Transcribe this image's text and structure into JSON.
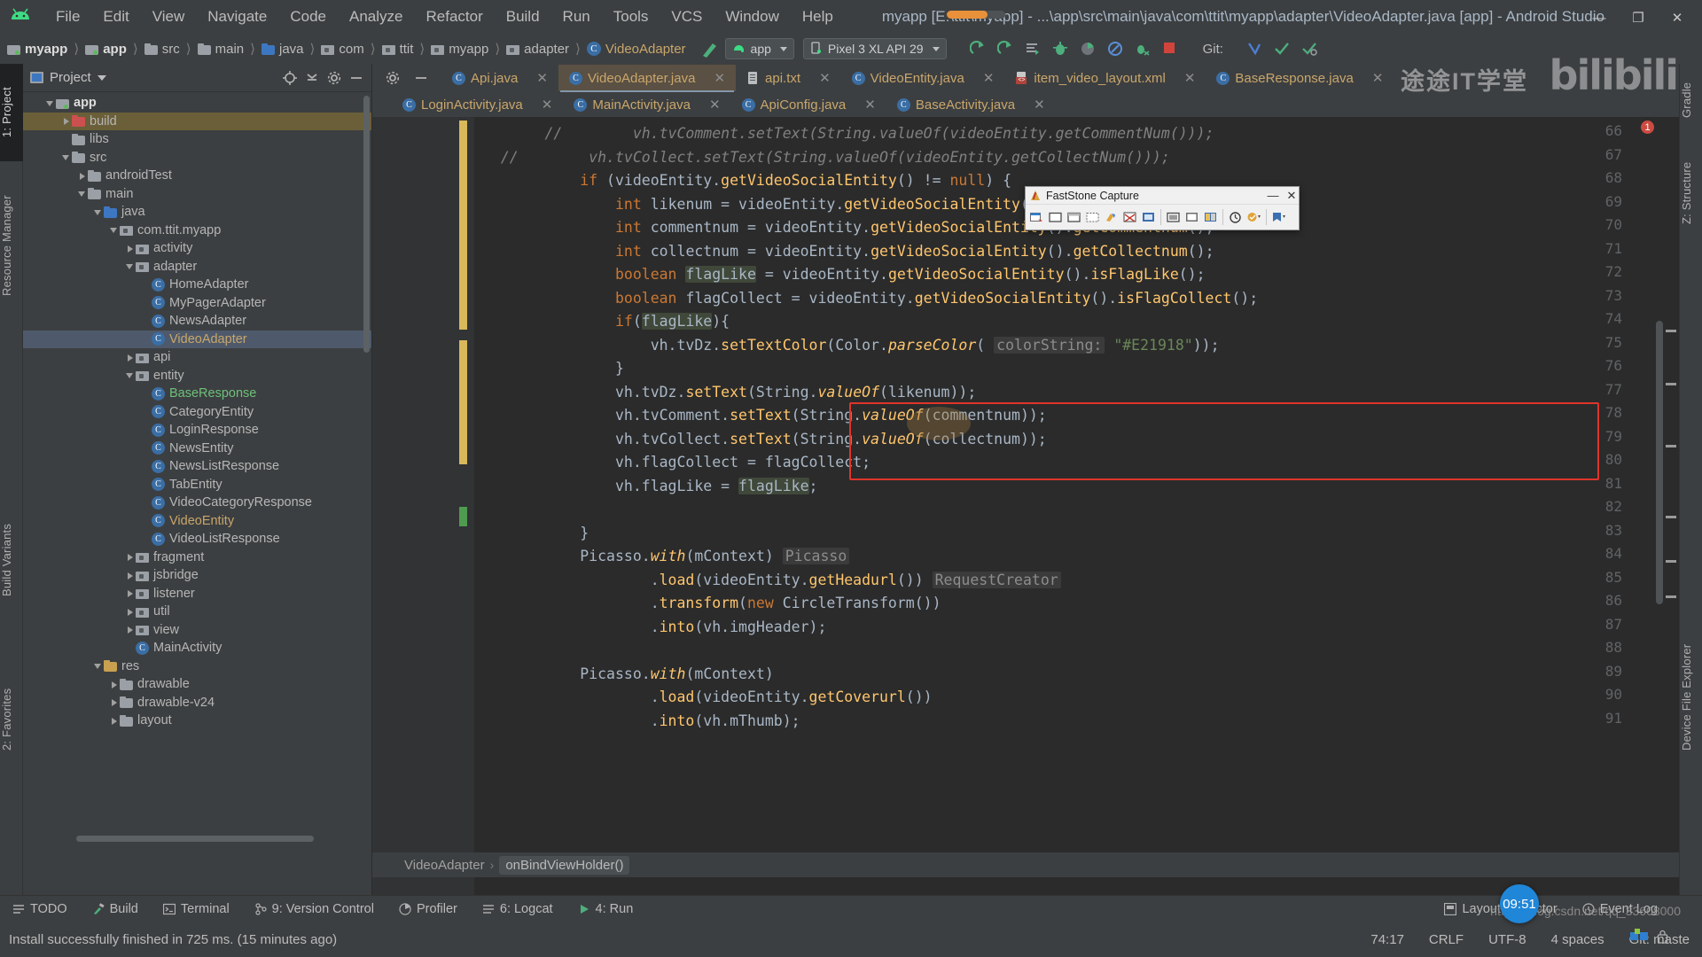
{
  "window": {
    "title": "myapp [E:\\ttit\\myapp] - ...\\app\\src\\main\\java\\com\\ttit\\myapp\\adapter\\VideoAdapter.java [app] - Android Studio",
    "minimize": "—",
    "maximize": "❐",
    "close": "✕"
  },
  "menu": [
    "File",
    "Edit",
    "View",
    "Navigate",
    "Code",
    "Analyze",
    "Refactor",
    "Build",
    "Run",
    "Tools",
    "VCS",
    "Window",
    "Help"
  ],
  "breadcrumb": [
    {
      "label": "myapp",
      "icon": "module-folder-icon",
      "bold": true
    },
    {
      "label": "app",
      "icon": "module-folder-icon",
      "bold": true
    },
    {
      "label": "src",
      "icon": "folder-icon",
      "bold": false
    },
    {
      "label": "main",
      "icon": "folder-icon",
      "bold": false
    },
    {
      "label": "java",
      "icon": "source-folder-icon",
      "bold": false
    },
    {
      "label": "com",
      "icon": "package-icon",
      "bold": false
    },
    {
      "label": "ttit",
      "icon": "package-icon",
      "bold": false
    },
    {
      "label": "myapp",
      "icon": "package-icon",
      "bold": false
    },
    {
      "label": "adapter",
      "icon": "package-icon",
      "bold": false
    },
    {
      "label": "VideoAdapter",
      "icon": "class-icon",
      "bold": false
    }
  ],
  "toolbar": {
    "run_config": "app",
    "device": "Pixel 3 XL API 29",
    "git_label": "Git:"
  },
  "project_panel": {
    "title": "Project",
    "tree": [
      {
        "label": "app",
        "depth": 1,
        "arrow": "down",
        "icon": "module-folder-icon",
        "bold": true,
        "state": "normal"
      },
      {
        "label": "build",
        "depth": 2,
        "arrow": "right",
        "icon": "folder-red-icon",
        "bold": false,
        "state": "highlight"
      },
      {
        "label": "libs",
        "depth": 2,
        "arrow": "none",
        "icon": "folder-icon",
        "bold": false,
        "state": "normal"
      },
      {
        "label": "src",
        "depth": 2,
        "arrow": "down",
        "icon": "folder-icon",
        "bold": false,
        "state": "normal"
      },
      {
        "label": "androidTest",
        "depth": 3,
        "arrow": "right",
        "icon": "folder-icon",
        "bold": false,
        "state": "normal"
      },
      {
        "label": "main",
        "depth": 3,
        "arrow": "down",
        "icon": "folder-icon",
        "bold": false,
        "state": "normal"
      },
      {
        "label": "java",
        "depth": 4,
        "arrow": "down",
        "icon": "source-folder-icon",
        "bold": false,
        "state": "normal"
      },
      {
        "label": "com.ttit.myapp",
        "depth": 5,
        "arrow": "down",
        "icon": "package-icon",
        "bold": false,
        "state": "normal"
      },
      {
        "label": "activity",
        "depth": 6,
        "arrow": "right",
        "icon": "package-icon",
        "bold": false,
        "state": "normal"
      },
      {
        "label": "adapter",
        "depth": 6,
        "arrow": "down",
        "icon": "package-icon",
        "bold": false,
        "state": "normal"
      },
      {
        "label": "HomeAdapter",
        "depth": 7,
        "arrow": "none",
        "icon": "class-icon",
        "bold": false,
        "state": "normal"
      },
      {
        "label": "MyPagerAdapter",
        "depth": 7,
        "arrow": "none",
        "icon": "class-icon",
        "bold": false,
        "state": "normal"
      },
      {
        "label": "NewsAdapter",
        "depth": 7,
        "arrow": "none",
        "icon": "class-icon",
        "bold": false,
        "state": "normal"
      },
      {
        "label": "VideoAdapter",
        "depth": 7,
        "arrow": "none",
        "icon": "class-icon",
        "bold": false,
        "state": "selected"
      },
      {
        "label": "api",
        "depth": 6,
        "arrow": "right",
        "icon": "package-icon",
        "bold": false,
        "state": "normal"
      },
      {
        "label": "entity",
        "depth": 6,
        "arrow": "down",
        "icon": "package-icon",
        "bold": false,
        "state": "normal"
      },
      {
        "label": "BaseResponse",
        "depth": 7,
        "arrow": "none",
        "icon": "class-icon",
        "bold": false,
        "state": "green"
      },
      {
        "label": "CategoryEntity",
        "depth": 7,
        "arrow": "none",
        "icon": "class-icon",
        "bold": false,
        "state": "normal"
      },
      {
        "label": "LoginResponse",
        "depth": 7,
        "arrow": "none",
        "icon": "class-icon",
        "bold": false,
        "state": "normal"
      },
      {
        "label": "NewsEntity",
        "depth": 7,
        "arrow": "none",
        "icon": "class-icon",
        "bold": false,
        "state": "normal"
      },
      {
        "label": "NewsListResponse",
        "depth": 7,
        "arrow": "none",
        "icon": "class-icon",
        "bold": false,
        "state": "normal"
      },
      {
        "label": "TabEntity",
        "depth": 7,
        "arrow": "none",
        "icon": "class-icon",
        "bold": false,
        "state": "normal"
      },
      {
        "label": "VideoCategoryResponse",
        "depth": 7,
        "arrow": "none",
        "icon": "class-icon",
        "bold": false,
        "state": "normal"
      },
      {
        "label": "VideoEntity",
        "depth": 7,
        "arrow": "none",
        "icon": "class-icon",
        "bold": false,
        "state": "orange"
      },
      {
        "label": "VideoListResponse",
        "depth": 7,
        "arrow": "none",
        "icon": "class-icon",
        "bold": false,
        "state": "normal"
      },
      {
        "label": "fragment",
        "depth": 6,
        "arrow": "right",
        "icon": "package-icon",
        "bold": false,
        "state": "normal"
      },
      {
        "label": "jsbridge",
        "depth": 6,
        "arrow": "right",
        "icon": "package-icon",
        "bold": false,
        "state": "normal"
      },
      {
        "label": "listener",
        "depth": 6,
        "arrow": "right",
        "icon": "package-icon",
        "bold": false,
        "state": "normal"
      },
      {
        "label": "util",
        "depth": 6,
        "arrow": "right",
        "icon": "package-icon",
        "bold": false,
        "state": "normal"
      },
      {
        "label": "view",
        "depth": 6,
        "arrow": "right",
        "icon": "package-icon",
        "bold": false,
        "state": "normal"
      },
      {
        "label": "MainActivity",
        "depth": 6,
        "arrow": "none",
        "icon": "class-icon",
        "bold": false,
        "state": "normal"
      },
      {
        "label": "res",
        "depth": 4,
        "arrow": "down",
        "icon": "folder-res-icon",
        "bold": false,
        "state": "normal"
      },
      {
        "label": "drawable",
        "depth": 5,
        "arrow": "right",
        "icon": "folder-icon",
        "bold": false,
        "state": "normal"
      },
      {
        "label": "drawable-v24",
        "depth": 5,
        "arrow": "right",
        "icon": "folder-icon",
        "bold": false,
        "state": "normal"
      },
      {
        "label": "layout",
        "depth": 5,
        "arrow": "right",
        "icon": "folder-icon",
        "bold": false,
        "state": "normal"
      }
    ]
  },
  "left_strip": [
    {
      "label": "1: Project",
      "selected": true
    },
    {
      "label": "Resource Manager",
      "selected": false
    },
    {
      "label": "Build Variants",
      "selected": false
    },
    {
      "label": "2: Favorites",
      "selected": false
    }
  ],
  "right_strip": [
    {
      "label": "Gradle"
    },
    {
      "label": "Z: Structure"
    },
    {
      "label": "Device File Explorer"
    }
  ],
  "editor_tabs_row1": [
    {
      "label": "Api.java",
      "icon": "java-class-icon",
      "active": false
    },
    {
      "label": "VideoAdapter.java",
      "icon": "java-class-icon",
      "active": true
    },
    {
      "label": "api.txt",
      "icon": "text-file-icon",
      "active": false
    },
    {
      "label": "VideoEntity.java",
      "icon": "java-class-icon",
      "active": false
    },
    {
      "label": "item_video_layout.xml",
      "icon": "xml-file-icon",
      "active": false
    },
    {
      "label": "BaseResponse.java",
      "icon": "java-class-icon",
      "active": false
    }
  ],
  "editor_tabs_row2": [
    {
      "label": "LoginActivity.java",
      "icon": "java-class-icon",
      "active": false
    },
    {
      "label": "MainActivity.java",
      "icon": "java-class-icon",
      "active": false
    },
    {
      "label": "ApiConfig.java",
      "icon": "java-class-icon",
      "active": false
    },
    {
      "label": "BaseActivity.java",
      "icon": "java-class-icon",
      "active": false
    }
  ],
  "code": {
    "first_line_number": 66,
    "lines": [
      {
        "n": 66,
        "html": "        <span class='c'>//        vh.tvComment.setText(String.valueOf(videoEntity.getCommentNum()));</span>"
      },
      {
        "n": 67,
        "html": "   <span class='c'>//        vh.tvCollect.setText(String.valueOf(videoEntity.getCollectNum()));</span>"
      },
      {
        "n": 68,
        "html": "            <span class='k'>if</span> <span class='p'>(videoEntity.</span><span class='m'>getVideoSocialEntity</span><span class='p'>() != </span><span class='k'>null</span><span class='p'>) {</span>"
      },
      {
        "n": 69,
        "html": "                <span class='k'>int</span> <span class='p'>likenum = videoEntity.</span><span class='m'>getVideoSocialEntity</span><span class='p'>().</span><span class='m'>getLikenum</span><span class='p'>();</span>"
      },
      {
        "n": 70,
        "html": "                <span class='k'>int</span> <span class='p'>commentnum = videoEntity.</span><span class='m'>getVideoSocialEntity</span><span class='p'>().</span><span class='m'>getCommentnum</span><span class='p'>();</span>"
      },
      {
        "n": 71,
        "html": "                <span class='k'>int</span> <span class='p'>collectnum = videoEntity.</span><span class='m'>getVideoSocialEntity</span><span class='p'>().</span><span class='m'>getCollectnum</span><span class='p'>();</span>"
      },
      {
        "n": 72,
        "html": "                <span class='k'>boolean</span> <span class='hl-var'><span class='p'>flagLike</span></span><span class='p'> = videoEntity.</span><span class='m'>getVideoSocialEntity</span><span class='p'>().</span><span class='m'>isFlagLike</span><span class='p'>();</span>"
      },
      {
        "n": 73,
        "html": "                <span class='k'>boolean</span> <span class='p'>flagCollect = videoEntity.</span><span class='m'>getVideoSocialEntity</span><span class='p'>().</span><span class='m'>isFlagCollect</span><span class='p'>();</span>"
      },
      {
        "n": 74,
        "html": "                <span class='k'>if</span><span class='p'>(</span><span class='hl-var'><span class='p'>flagLike</span></span><span class='p'>){</span>"
      },
      {
        "n": 75,
        "html": "                    <span class='p'>vh.tvDz.</span><span class='m'>setTextColor</span><span class='p'>(Color.</span><span class='m' style='font-style:italic'>parseColor</span><span class='p'>( </span><span class='hint'>colorString:</span><span class='p'> </span><span class='s'>\"#E21918\"</span><span class='p'>));</span>"
      },
      {
        "n": 76,
        "html": "                <span class='p'>}</span>"
      },
      {
        "n": 77,
        "html": "                <span class='p'>vh.tvDz.</span><span class='m'>setText</span><span class='p'>(String.</span><span class='m' style='font-style:italic'>valueOf</span><span class='p'>(likenum));</span>"
      },
      {
        "n": 78,
        "html": "                <span class='p'>vh.tvComment.</span><span class='m'>setText</span><span class='p'>(String.</span><span class='m' style='font-style:italic'>valueOf</span><span class='p'>(commentnum));</span>"
      },
      {
        "n": 79,
        "html": "                <span class='p'>vh.tvCollect.</span><span class='m'>setText</span><span class='p'>(String.</span><span class='m' style='font-style:italic'>valueOf</span><span class='p'>(collectnum));</span>"
      },
      {
        "n": 80,
        "html": "                <span class='p'>vh.flagCollect = flagCollect;</span>"
      },
      {
        "n": 81,
        "html": "                <span class='p'>vh.flagLike = </span><span class='hl-var'><span class='p'>flagLike</span></span><span class='p'>;</span>"
      },
      {
        "n": 82,
        "html": ""
      },
      {
        "n": 83,
        "html": "            <span class='p'>}</span>"
      },
      {
        "n": 84,
        "html": "            <span class='p'>Picasso.</span><span class='m' style='font-style:italic'>with</span><span class='p'>(mContext)</span> <span class='hint'>Picasso</span>"
      },
      {
        "n": 85,
        "html": "                    <span class='p'>.</span><span class='m'>load</span><span class='p'>(videoEntity.</span><span class='m'>getHeadurl</span><span class='p'>())</span> <span class='hint'>RequestCreator</span>"
      },
      {
        "n": 86,
        "html": "                    <span class='p'>.</span><span class='m'>transform</span><span class='p'>(</span><span class='k'>new</span> <span class='p'>CircleTransform())</span>"
      },
      {
        "n": 87,
        "html": "                    <span class='p'>.</span><span class='m'>into</span><span class='p'>(vh.imgHeader);</span>"
      },
      {
        "n": 88,
        "html": ""
      },
      {
        "n": 89,
        "html": "            <span class='p'>Picasso.</span><span class='m' style='font-style:italic'>with</span><span class='p'>(mContext)</span>"
      },
      {
        "n": 90,
        "html": "                    <span class='p'>.</span><span class='m'>load</span><span class='p'>(videoEntity.</span><span class='m'>getCoverurl</span><span class='p'>())</span>"
      },
      {
        "n": 91,
        "html": "                    <span class='p'>.</span><span class='m'>into</span><span class='p'>(vh.mThumb);</span>"
      }
    ],
    "error_count": "1"
  },
  "editor_breadcrumb": {
    "class": "VideoAdapter",
    "method": "onBindViewHolder()",
    "separator": "›"
  },
  "fastone": {
    "title": "FastStone Capture",
    "minimize": "—",
    "close": "✕",
    "buttons": [
      "capture-active-window-icon",
      "capture-window-object-icon",
      "capture-rectangle-icon",
      "capture-freehand-icon",
      "capture-fullscreen-icon",
      "capture-scrolling-window-icon",
      "capture-fixed-region-icon",
      "screen-recorder-icon",
      "repeat-last-capture-icon",
      "screen-magnifier-icon",
      "screen-color-picker-icon",
      "timer-capture-icon",
      "settings-icon",
      "send-to-icon"
    ]
  },
  "bottom_tools": [
    {
      "label": "TODO",
      "icon": "todo-icon"
    },
    {
      "label": "Build",
      "icon": "build-hammer-icon"
    },
    {
      "label": "Terminal",
      "icon": "terminal-icon"
    },
    {
      "label": "9: Version Control",
      "icon": "version-control-icon"
    },
    {
      "label": "Profiler",
      "icon": "profiler-icon"
    },
    {
      "label": "6: Logcat",
      "icon": "logcat-icon"
    },
    {
      "label": "4: Run",
      "icon": "run-icon"
    }
  ],
  "bottom_tools_right": [
    {
      "label": "Layout Inspector",
      "icon": "layout-inspector-icon"
    },
    {
      "label": "Event Log",
      "icon": "event-log-icon"
    }
  ],
  "status": {
    "message": "Install successfully finished in 725 ms. (15 minutes ago)",
    "caret": "74:17",
    "line_sep": "CRLF",
    "encoding": "UTF-8",
    "indent": "4 spaces",
    "git_branch": "Git: maste"
  },
  "overlay": {
    "watermark_text": "途途IT学堂",
    "watermark_brand": "bilibili",
    "watermark_url": "https://blog.csdn.net/qq_33608000",
    "clock": "09:51"
  },
  "colors": {
    "accent_orange": "#e8913a",
    "editor_bg": "#2b2b2b",
    "chrome_bg": "#3c3f41",
    "selection": "#4e5a6b",
    "error_red": "#e0342b",
    "string_green": "#6a8759",
    "keyword_orange": "#cc7832"
  }
}
